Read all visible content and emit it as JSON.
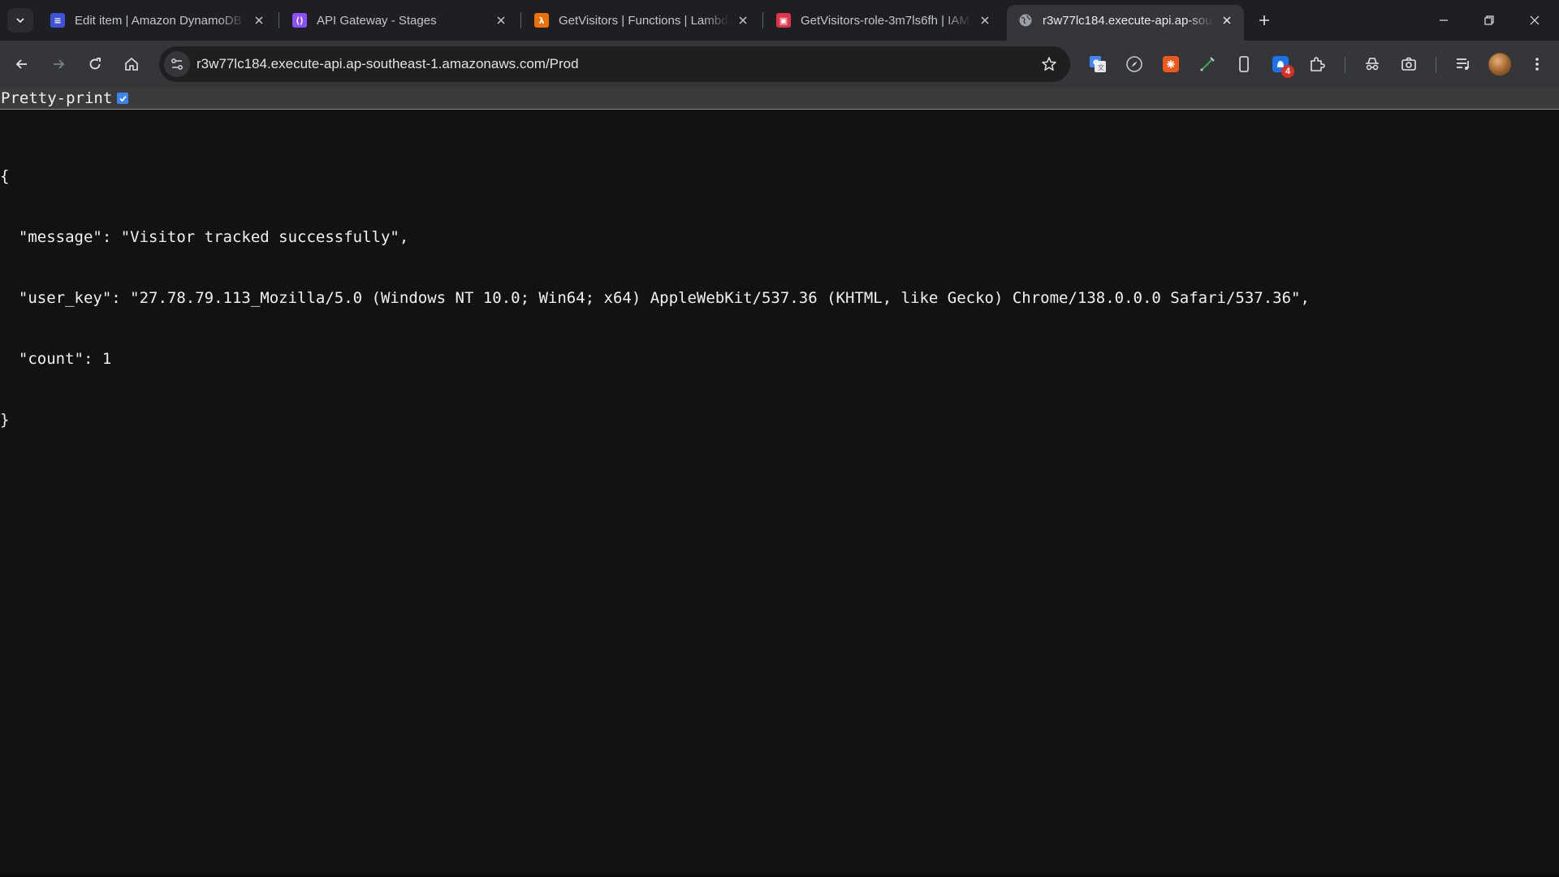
{
  "tabs": [
    {
      "title": "Edit item | Amazon DynamoDB",
      "favicon": "dynamodb-icon",
      "color": "#4053d6"
    },
    {
      "title": "API Gateway - Stages",
      "favicon": "api-gateway-icon",
      "color": "#8c4fff"
    },
    {
      "title": "GetVisitors | Functions | Lambda",
      "favicon": "lambda-icon",
      "color": "#ed7100"
    },
    {
      "title": "GetVisitors-role-3m7ls6fh | IAM",
      "favicon": "iam-icon",
      "color": "#dd344c"
    },
    {
      "title": "r3w77lc184.execute-api.ap-southeast-1.amazonaws.com/Prod",
      "favicon": "globe-icon",
      "color": "#9aa0a6"
    }
  ],
  "address_bar": {
    "url": "r3w77lc184.execute-api.ap-southeast-1.amazonaws.com/Prod"
  },
  "extensions": {
    "notification_badge": "4"
  },
  "page": {
    "pretty_print_label": "Pretty-print",
    "pretty_print_checked": true,
    "json_lines": [
      "{",
      "  \"message\": \"Visitor tracked successfully\",",
      "  \"user_key\": \"27.78.79.113_Mozilla/5.0 (Windows NT 10.0; Win64; x64) AppleWebKit/537.36 (KHTML, like Gecko) Chrome/138.0.0.0 Safari/537.36\",",
      "  \"count\": 1",
      "}"
    ]
  },
  "theme": {
    "background": "#121212",
    "tabstrip": "#1e1f22",
    "toolbar": "#35363a",
    "accent": "#3b82f6"
  }
}
